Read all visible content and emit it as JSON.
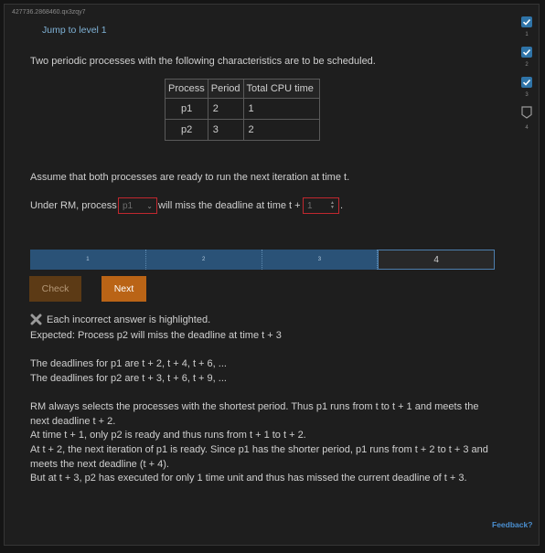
{
  "session_id": "427736.2868460.qx3zqy7",
  "jump_link": "Jump to level 1",
  "levels": [
    {
      "number": "1",
      "state": "complete",
      "icon": "checkbox-checked-icon"
    },
    {
      "number": "2",
      "state": "complete",
      "icon": "checkbox-checked-icon"
    },
    {
      "number": "3",
      "state": "complete",
      "icon": "checkbox-checked-icon"
    },
    {
      "number": "4",
      "state": "current",
      "icon": "level-shield-icon"
    }
  ],
  "intro": "Two periodic processes with the following characteristics are to be scheduled.",
  "table": {
    "headers": [
      "Process",
      "Period",
      "Total CPU time"
    ],
    "rows": [
      [
        "p1",
        "2",
        "1"
      ],
      [
        "p2",
        "3",
        "2"
      ]
    ]
  },
  "assume": "Assume that both processes are ready to run the next iteration at time t.",
  "question": {
    "prefix": "Under RM, process",
    "middle": "will miss the deadline at time t +",
    "suffix": ".",
    "process_select_value": "p1",
    "time_input_value": "1"
  },
  "progress": {
    "segments": [
      "1",
      "2",
      "3",
      "4"
    ],
    "current": "4"
  },
  "buttons": {
    "check": "Check",
    "next": "Next"
  },
  "feedback_text": {
    "incorrect": "Each incorrect answer is highlighted.",
    "expected": "Expected: Process p2 will miss the deadline at time t + 3",
    "deadlines_p1": "The deadlines for p1 are t + 2, t + 4, t + 6, ...",
    "deadlines_p2": "The deadlines for p2 are t + 3, t + 6, t + 9, ...",
    "explain_1a": "RM always selects the processes with the shortest period. Thus p1 runs from t to t + 1 and meets the",
    "explain_1b": "next deadline t + 2.",
    "explain_2": "At time t + 1, only p2 is ready and thus runs from t + 1 to t + 2.",
    "explain_3a": "At t + 2, the next iteration of p1 is ready. Since p1 has the shorter period, p1 runs from t + 2 to t + 3 and",
    "explain_3b": "meets the next deadline (t + 4).",
    "explain_4": "But at t + 3, p2 has executed for only 1 time unit and thus has missed the current deadline of t + 3."
  },
  "feedback_link": "Feedback?",
  "colors": {
    "accent_blue": "#2f74a8",
    "next_orange": "#ba6416",
    "error_red": "#c0282f",
    "link_blue": "#7fb2d6"
  }
}
